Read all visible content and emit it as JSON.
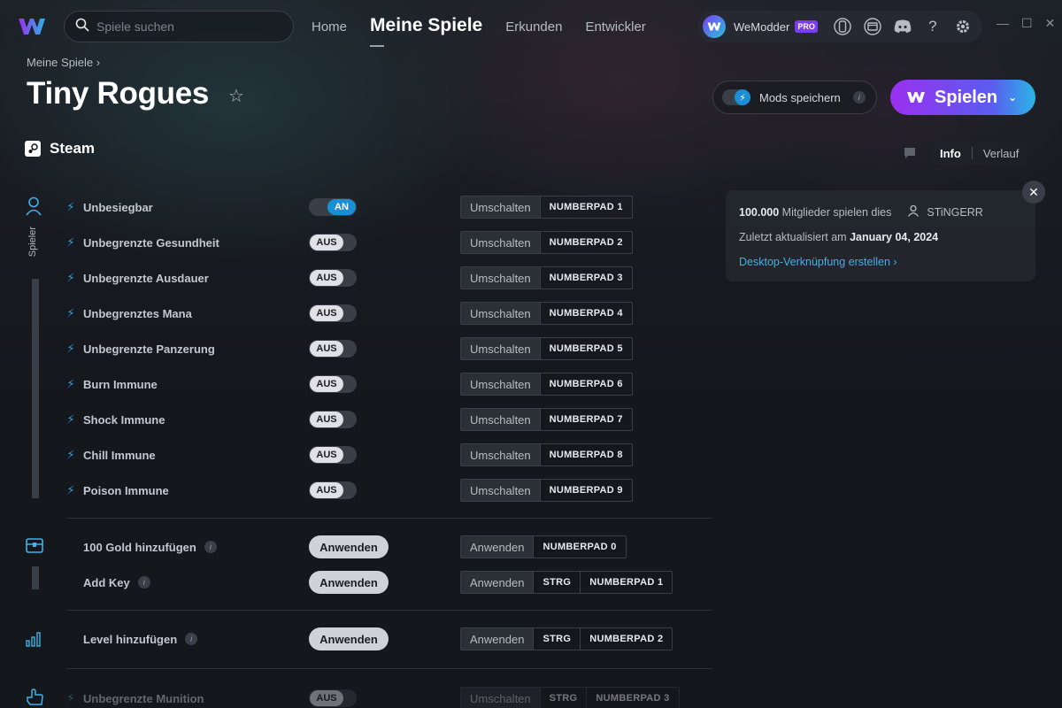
{
  "app": {
    "name": "WeModder",
    "badge": "PRO"
  },
  "search": {
    "placeholder": "Spiele suchen"
  },
  "nav": [
    {
      "label": "Home"
    },
    {
      "label": "Meine Spiele"
    },
    {
      "label": "Erkunden"
    },
    {
      "label": "Entwickler"
    }
  ],
  "breadcrumb": {
    "label": "Meine Spiele ›"
  },
  "game": {
    "title": "Tiny Rogues",
    "platform": "Steam"
  },
  "header": {
    "save_mods_label": "Mods speichern",
    "play_label": "Spielen"
  },
  "tabs": {
    "info": "Info",
    "history": "Verlauf"
  },
  "info_card": {
    "members_count": "100.000",
    "members_text": "Mitglieder spielen dies",
    "creator": "STiNGERR",
    "updated_prefix": "Zuletzt aktualisiert am",
    "updated_date": "January 04, 2024",
    "shortcut_link": "Desktop-Verknüpfung erstellen ›"
  },
  "rail": {
    "player_label": "Spieler"
  },
  "cheats": {
    "player": [
      {
        "name": "Unbesiegbar",
        "state": "AN",
        "action": "Umschalten",
        "keys": [
          "NUMBERPAD 1"
        ]
      },
      {
        "name": "Unbegrenzte Gesundheit",
        "state": "AUS",
        "action": "Umschalten",
        "keys": [
          "NUMBERPAD 2"
        ]
      },
      {
        "name": "Unbegrenzte Ausdauer",
        "state": "AUS",
        "action": "Umschalten",
        "keys": [
          "NUMBERPAD 3"
        ]
      },
      {
        "name": "Unbegrenztes Mana",
        "state": "AUS",
        "action": "Umschalten",
        "keys": [
          "NUMBERPAD 4"
        ]
      },
      {
        "name": "Unbegrenzte Panzerung",
        "state": "AUS",
        "action": "Umschalten",
        "keys": [
          "NUMBERPAD 5"
        ]
      },
      {
        "name": "Burn Immune",
        "state": "AUS",
        "action": "Umschalten",
        "keys": [
          "NUMBERPAD 6"
        ]
      },
      {
        "name": "Shock Immune",
        "state": "AUS",
        "action": "Umschalten",
        "keys": [
          "NUMBERPAD 7"
        ]
      },
      {
        "name": "Chill Immune",
        "state": "AUS",
        "action": "Umschalten",
        "keys": [
          "NUMBERPAD 8"
        ]
      },
      {
        "name": "Poison Immune",
        "state": "AUS",
        "action": "Umschalten",
        "keys": [
          "NUMBERPAD 9"
        ]
      }
    ],
    "inventory": [
      {
        "name": "100 Gold hinzufügen",
        "button": "Anwenden",
        "action": "Anwenden",
        "keys": [
          "NUMBERPAD 0"
        ]
      },
      {
        "name": "Add Key",
        "button": "Anwenden",
        "action": "Anwenden",
        "keys": [
          "STRG",
          "NUMBERPAD 1"
        ]
      }
    ],
    "stats": [
      {
        "name": "Level hinzufügen",
        "button": "Anwenden",
        "action": "Anwenden",
        "keys": [
          "STRG",
          "NUMBERPAD 2"
        ]
      }
    ],
    "weapons": [
      {
        "name": "Unbegrenzte Munition",
        "state": "AUS",
        "action": "Umschalten",
        "keys": [
          "STRG",
          "NUMBERPAD 3"
        ]
      }
    ]
  },
  "colors": {
    "accent": "#1a8fd6",
    "brand_purple": "#7b3cf3",
    "brand_cyan": "#26c3d9"
  },
  "icons": [
    "wemod-logo-icon",
    "search-icon",
    "controller-icon",
    "window-icon",
    "discord-icon",
    "help-icon",
    "gear-icon",
    "star-icon",
    "steam-icon",
    "flag-icon",
    "user-icon",
    "close-icon",
    "bolt-icon",
    "chest-icon",
    "bar-chart-icon",
    "hand-icon"
  ]
}
